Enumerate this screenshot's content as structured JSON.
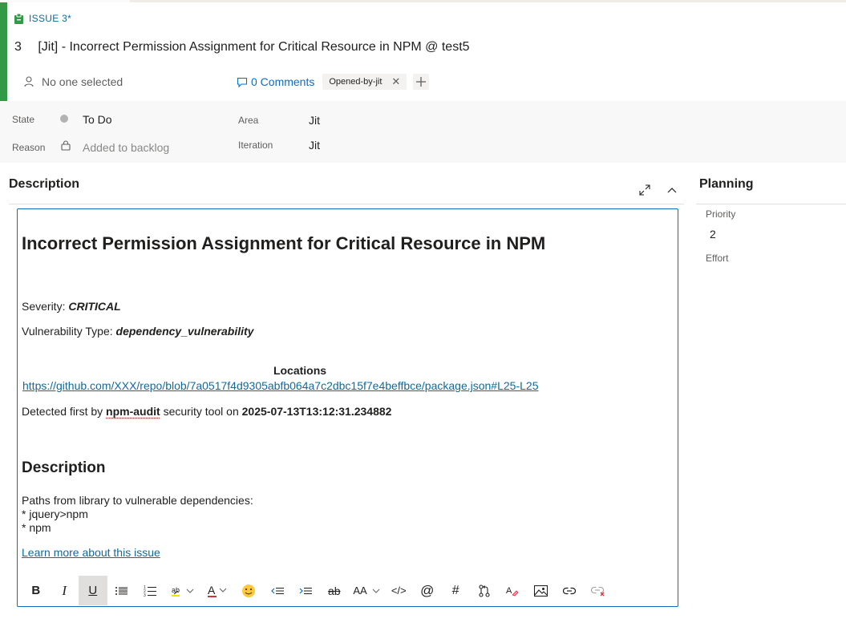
{
  "header": {
    "work_item_type": "ISSUE 3*",
    "id": "3",
    "title": "[Jit] - Incorrect Permission Assignment for Critical Resource in NPM @ test5",
    "assignee": "No one selected",
    "comments": "0 Comments",
    "tags": [
      "Opened-by-jit"
    ],
    "accent_color": "#339947"
  },
  "fields": {
    "state_label": "State",
    "state_value": "To Do",
    "reason_label": "Reason",
    "reason_value": "Added to backlog",
    "area_label": "Area",
    "area_value": "Jit",
    "iteration_label": "Iteration",
    "iteration_value": "Jit"
  },
  "description": {
    "section_title": "Description",
    "heading": "Incorrect Permission Assignment for Critical Resource in NPM",
    "severity_label": "Severity: ",
    "severity_value": "CRITICAL",
    "vuln_type_label": "Vulnerability Type: ",
    "vuln_type_value": "dependency_vulnerability",
    "locations_heading": "Locations",
    "location_url": "https://github.com/XXX/repo/blob/7a0517f4d9305abfb064a7c2dbc15f7e4beffbce/package.json#L25-L25",
    "detected_prefix": "Detected first by ",
    "detected_tool": "npm-audit",
    "detected_middle": " security tool on ",
    "detected_date": "2025-07-13T13:12:31.234882",
    "subheading": "Description",
    "paths_intro": "Paths from library to vulnerable dependencies:",
    "paths": [
      "* jquery>npm",
      "* npm"
    ],
    "learn_more": "Learn more about this issue"
  },
  "toolbar": {
    "buttons": [
      "bold-icon",
      "italic-icon",
      "underline-icon",
      "bulleted-list-icon",
      "numbered-list-icon",
      "highlight-icon",
      "font-color-icon",
      "emoji-icon",
      "decrease-indent-icon",
      "increase-indent-icon",
      "strikethrough-icon",
      "font-size-icon",
      "code-icon",
      "mention-icon",
      "work-item-link-icon",
      "pull-request-icon",
      "clear-format-icon",
      "image-icon",
      "link-icon",
      "unlink-icon"
    ],
    "bold": "B",
    "italic": "I",
    "underline": "U",
    "strike": "ab",
    "font_size": "AA",
    "code": "</>",
    "mention": "@",
    "hash": "#"
  },
  "planning": {
    "title": "Planning",
    "priority_label": "Priority",
    "priority_value": "2",
    "effort_label": "Effort"
  }
}
